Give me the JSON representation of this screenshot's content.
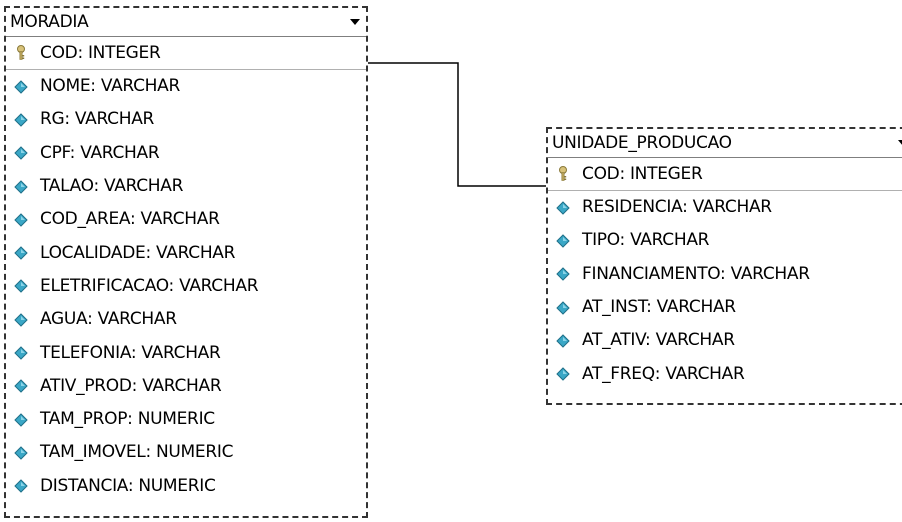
{
  "entities": {
    "moradia": {
      "name": "MORADIA",
      "primary_key": {
        "label": "COD: INTEGER",
        "icon": "key-icon"
      },
      "attributes": [
        "NOME: VARCHAR",
        "RG: VARCHAR",
        "CPF: VARCHAR",
        "TALAO: VARCHAR",
        "COD_AREA: VARCHAR",
        "LOCALIDADE: VARCHAR",
        "ELETRIFICACAO: VARCHAR",
        "AGUA: VARCHAR",
        "TELEFONIA: VARCHAR",
        "ATIV_PROD: VARCHAR",
        "TAM_PROP: NUMERIC",
        "TAM_IMOVEL: NUMERIC",
        "DISTANCIA: NUMERIC"
      ]
    },
    "unidade_producao": {
      "name": "UNIDADE_PRODUCAO",
      "primary_key": {
        "label": "COD: INTEGER",
        "icon": "key-icon"
      },
      "attributes": [
        "RESIDENCIA: VARCHAR",
        "TIPO: VARCHAR",
        "FINANCIAMENTO: VARCHAR",
        "AT_INST: VARCHAR",
        "AT_ATIV: VARCHAR",
        "AT_FREQ: VARCHAR"
      ]
    }
  },
  "colors": {
    "attribute_icon": "#3aa7c6",
    "key_icon": "#b8a25a",
    "border": "#333333"
  }
}
